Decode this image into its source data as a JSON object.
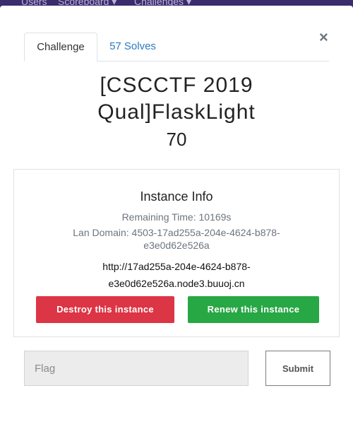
{
  "background_nav": {
    "items": [
      "Users",
      "Scoreboard ▾",
      "Challenges ▾"
    ]
  },
  "tabs": [
    {
      "label": "Challenge",
      "active": true
    },
    {
      "label": "57 Solves",
      "active": false
    }
  ],
  "close_label": "×",
  "challenge": {
    "title_line1": "[CSCCTF 2019",
    "title_line2": "Qual]FlaskLight",
    "points": "70"
  },
  "instance": {
    "title": "Instance Info",
    "remaining_time": "Remaining Time: 10169s",
    "lan_domain_line1": "Lan Domain: 4503-17ad255a-204e-4624-b878-",
    "lan_domain_line2": "e3e0d62e526a",
    "url_line1": "http://17ad255a-204e-4624-b878-",
    "url_line2": "e3e0d62e526a.node3.buuoj.cn",
    "destroy_label": "Destroy this instance",
    "renew_label": "Renew this instance"
  },
  "flag": {
    "placeholder": "Flag",
    "value": "",
    "submit_label": "Submit"
  },
  "colors": {
    "accent_link": "#2a7ac0",
    "danger": "#dc3545",
    "success": "#28a745",
    "backdrop": "#3a2a6a"
  }
}
